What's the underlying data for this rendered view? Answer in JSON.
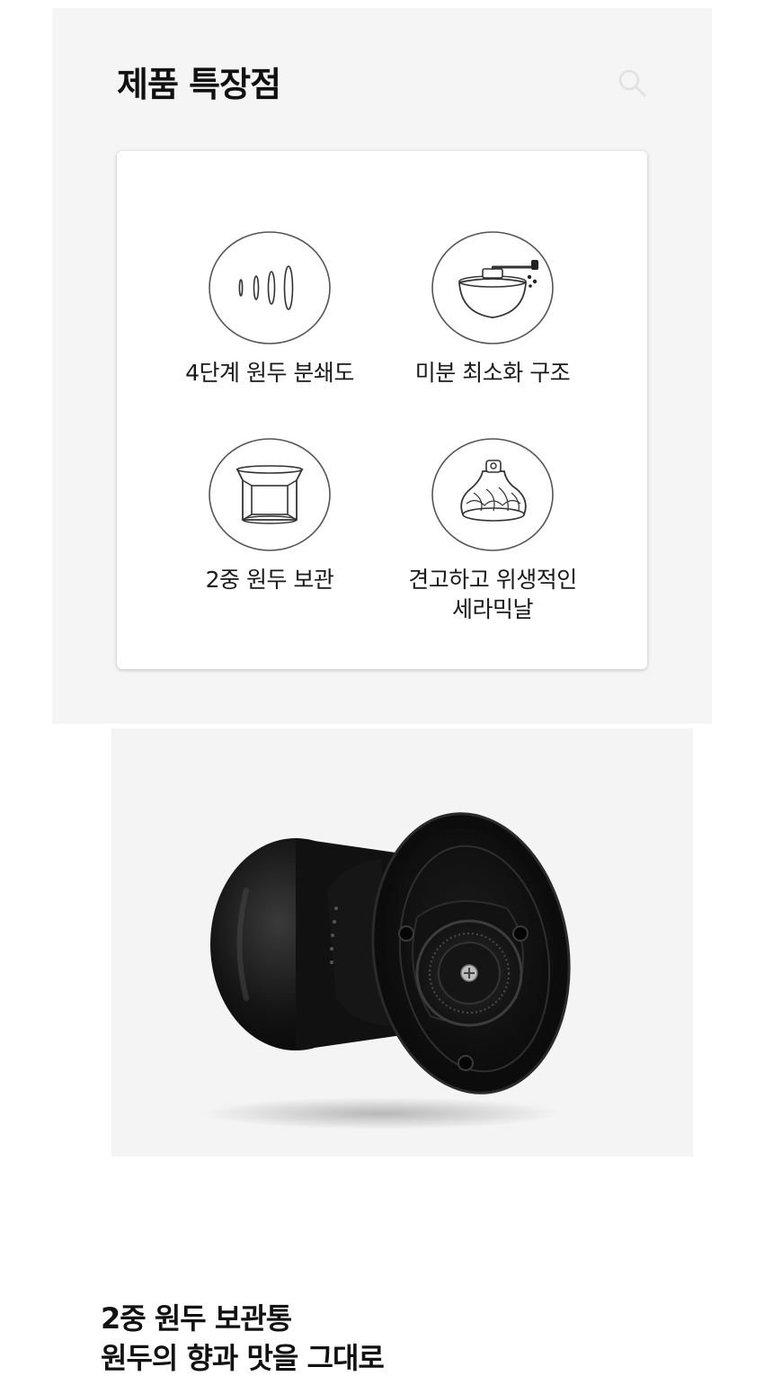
{
  "section": {
    "title": "제품 특장점"
  },
  "features": [
    {
      "label": "4단계 원두 분쇄도",
      "icon": "grind-levels-icon"
    },
    {
      "label": "미분 최소화 구조",
      "icon": "grinder-bowl-icon"
    },
    {
      "label": "2중 원두 보관",
      "icon": "double-container-icon"
    },
    {
      "label_lines": [
        "견고하고 위생적인",
        "세라믹날"
      ],
      "icon": "ceramic-burr-icon"
    }
  ],
  "bottom_text": {
    "line1": "2중 원두 보관통",
    "line2": "원두의 향과 맛을 그대로"
  },
  "colors": {
    "section_bg": "#f5f5f5",
    "card_bg": "#ffffff",
    "text": "#111111",
    "icon_stroke": "#333333"
  }
}
